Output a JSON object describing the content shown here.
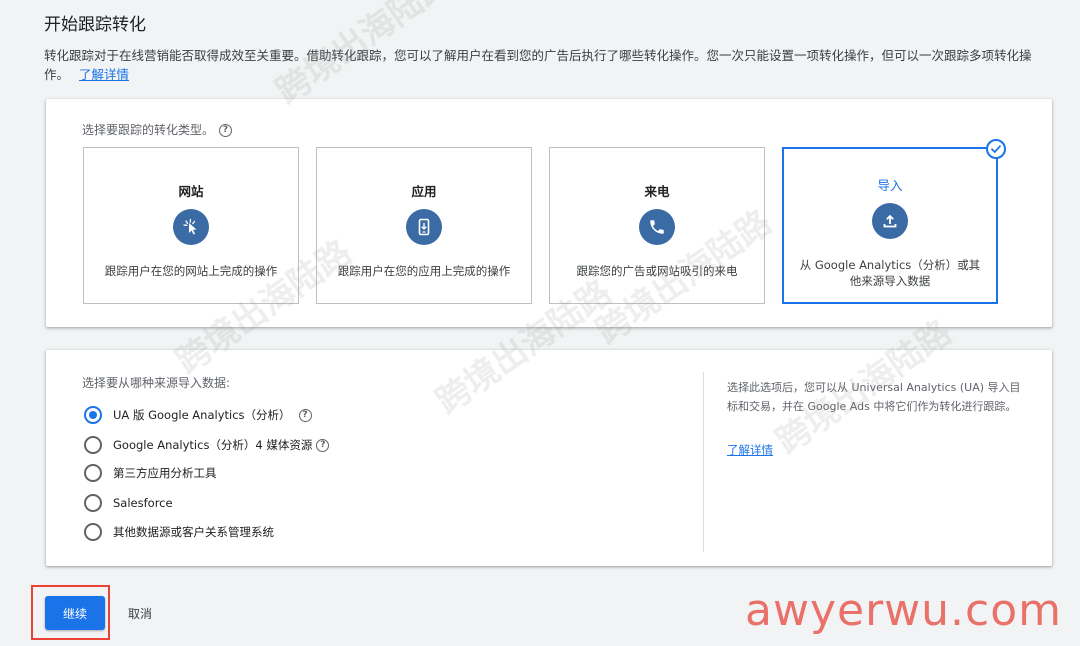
{
  "page": {
    "title": "开始跟踪转化",
    "intro": "转化跟踪对于在线营销能否取得成效至关重要。借助转化跟踪，您可以了解用户在看到您的广告后执行了哪些转化操作。您一次只能设置一项转化操作，但可以一次跟踪多项转化操作。",
    "learn_more": "了解详情"
  },
  "conversion_types": {
    "label": "选择要跟踪的转化类型。",
    "options": [
      {
        "title": "网站",
        "desc": "跟踪用户在您的网站上完成的操作",
        "icon": "cursor-click-icon",
        "selected": false
      },
      {
        "title": "应用",
        "desc": "跟踪用户在您的应用上完成的操作",
        "icon": "mobile-app-icon",
        "selected": false
      },
      {
        "title": "来电",
        "desc": "跟踪您的广告或网站吸引的来电",
        "icon": "phone-icon",
        "selected": false
      },
      {
        "title": "导入",
        "desc": "从 Google Analytics（分析）或其他来源导入数据",
        "icon": "upload-icon",
        "selected": true
      }
    ]
  },
  "import_source": {
    "label": "选择要从哪种来源导入数据:",
    "options": [
      {
        "label": "UA 版 Google Analytics（分析）",
        "checked": true,
        "help": true
      },
      {
        "label": "Google Analytics（分析）4 媒体资源",
        "checked": false,
        "help": true
      },
      {
        "label": "第三方应用分析工具",
        "checked": false,
        "help": false
      },
      {
        "label": "Salesforce",
        "checked": false,
        "help": false
      },
      {
        "label": "其他数据源或客户关系管理系统",
        "checked": false,
        "help": false
      }
    ],
    "side_text": "选择此选项后，您可以从 Universal Analytics (UA) 导入目标和交易，并在 Google Ads 中将它们作为转化进行跟踪。",
    "side_link": "了解详情"
  },
  "actions": {
    "continue": "继续",
    "cancel": "取消"
  },
  "watermarks": {
    "site": "awyerwu.com",
    "text": "跨境出海陆路"
  },
  "colors": {
    "accent": "#1a73e8",
    "icon_bg": "#3a6ba5",
    "highlight": "#ea4335"
  }
}
